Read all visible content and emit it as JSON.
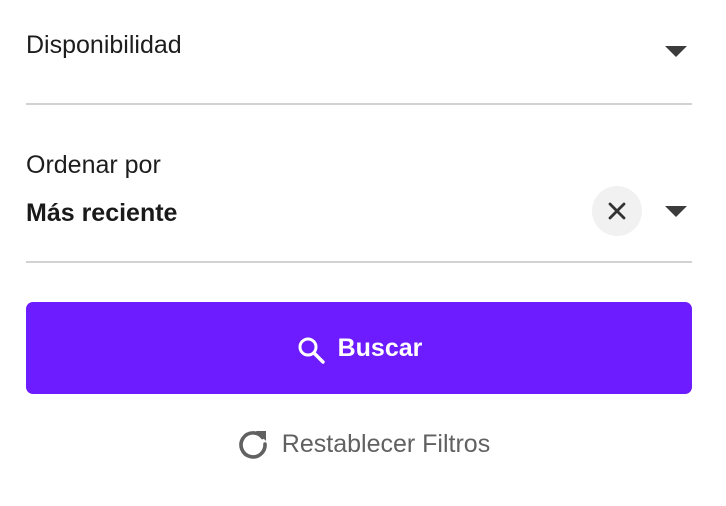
{
  "filters": {
    "availability": {
      "label": "Disponibilidad"
    },
    "order": {
      "label": "Ordenar por",
      "value": "Más reciente"
    }
  },
  "actions": {
    "search_label": "Buscar",
    "reset_label": "Restablecer Filtros"
  },
  "icons": {
    "dropdown": "caret-down-icon",
    "clear": "close-icon",
    "search": "search-icon",
    "reset": "refresh-icon"
  },
  "colors": {
    "primary": "#6c1cff",
    "divider": "#d2d2d2",
    "text": "#1d1d1d",
    "muted_text": "#616161",
    "clear_bg": "#f1f1f1"
  }
}
